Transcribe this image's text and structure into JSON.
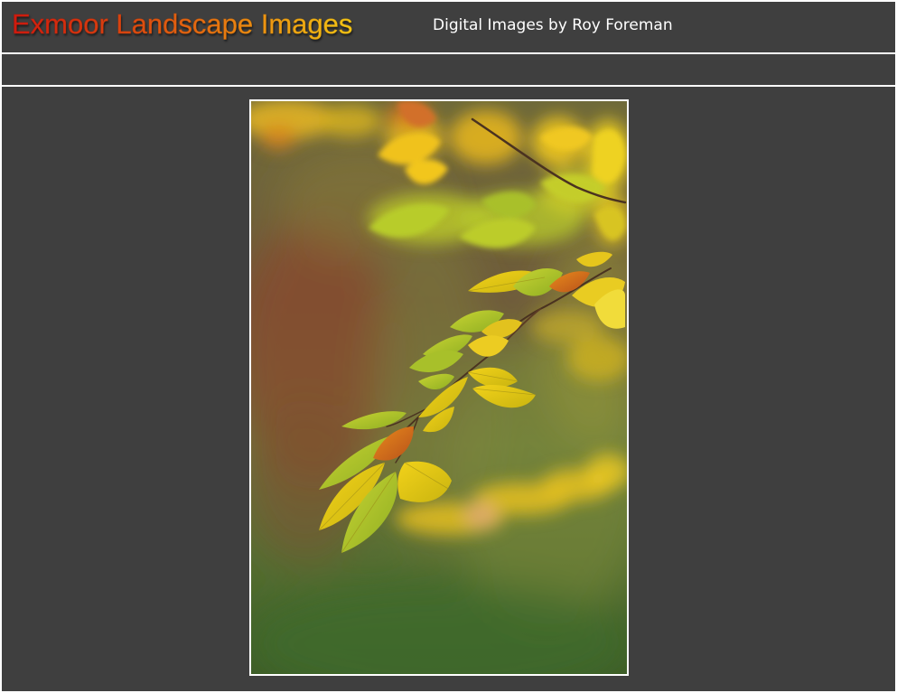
{
  "header": {
    "site_title": "Exmoor Landscape Images",
    "subtitle": "Digital Images by Roy Foreman"
  },
  "photo": {
    "subject": "autumn-beech-leaves",
    "colors": {
      "background_dark": "#3f3f3f",
      "title_gradient_start": "#d01a0e",
      "title_gradient_end": "#f4c414",
      "border": "#ffffff"
    }
  }
}
